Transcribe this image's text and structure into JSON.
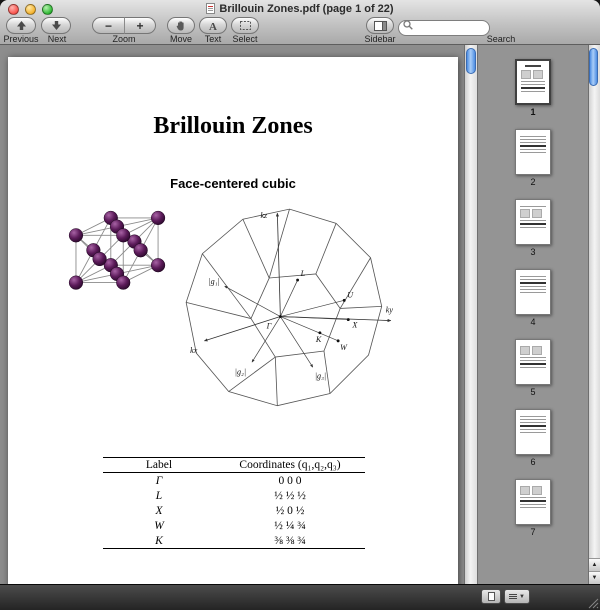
{
  "window": {
    "title": "Brillouin Zones.pdf (page 1 of 22)"
  },
  "toolbar": {
    "previous_label": "Previous",
    "next_label": "Next",
    "zoom_label": "Zoom",
    "zoom_out": "−",
    "zoom_in": "+",
    "move_label": "Move",
    "text_label": "Text",
    "select_label": "Select",
    "sidebar_label": "Sidebar",
    "search_label": "Search",
    "search_value": ""
  },
  "document": {
    "title": "Brillouin Zones",
    "subtitle": "Face-centered cubic",
    "figure": {
      "axis_labels": {
        "kx": "kx",
        "ky": "ky",
        "kz": "kz"
      },
      "point_labels": {
        "gamma": "Γ",
        "l": "L",
        "x": "X",
        "w": "W",
        "k": "K",
        "u": "U"
      },
      "vector_labels": {
        "g1": "|g₁|",
        "g2": "|g₂|",
        "g3": "|g₃|"
      }
    },
    "table": {
      "col_label": "Label",
      "col_coords": "Coordinates (q₁,q₂,q₃)",
      "rows": [
        {
          "label": "Γ",
          "coords": "0 0 0"
        },
        {
          "label": "L",
          "coords": "½ ½ ½"
        },
        {
          "label": "X",
          "coords": "½ 0 ½"
        },
        {
          "label": "W",
          "coords": "½ ¼ ¾"
        },
        {
          "label": "K",
          "coords": "⅜ ⅜ ¾"
        }
      ]
    }
  },
  "sidebar": {
    "pages": [
      "1",
      "2",
      "3",
      "4",
      "5",
      "6",
      "7"
    ],
    "selected_page": "1"
  }
}
